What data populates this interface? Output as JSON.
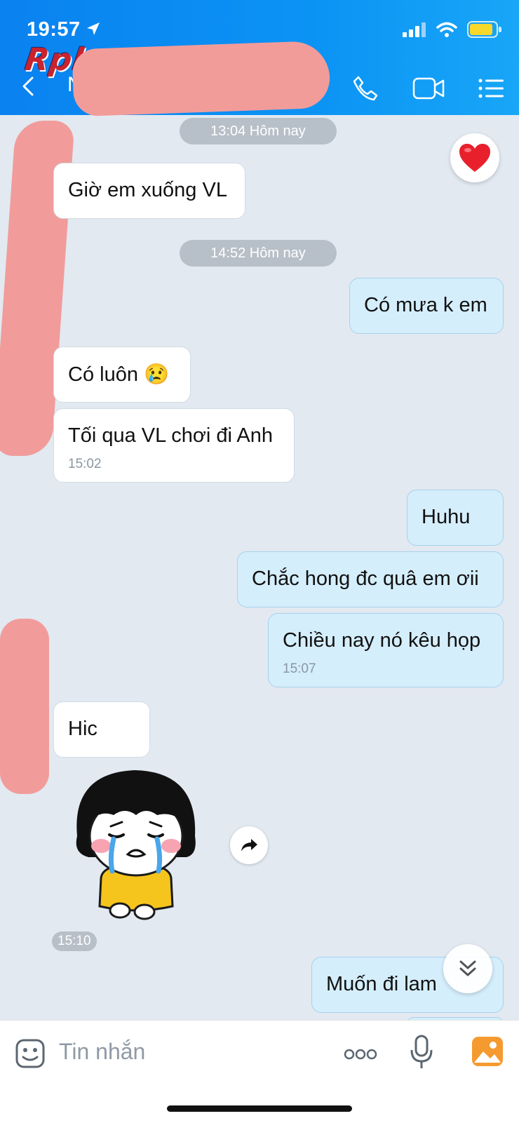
{
  "status_bar": {
    "time": "19:57"
  },
  "watermark": "Rphangx",
  "header": {
    "contact_name": "N"
  },
  "messages": {
    "sep1": "13:04 Hôm nay",
    "m1": "Giờ em xuống VL",
    "sep2": "14:52 Hôm nay",
    "m2": "Có mưa k em",
    "m3": "Có luôn 😢",
    "m4": "Tối qua VL chơi đi Anh",
    "m4_time": "15:02",
    "m5": "Huhu",
    "m6": "Chắc hong đc quâ em ơii",
    "m7": "Chiều nay nó kêu họp",
    "m7_time": "15:07",
    "m8": "Hic",
    "sticker_time": "15:10",
    "m9": "Muốn đi lam"
  },
  "input": {
    "placeholder": "Tin nhắn"
  },
  "colors": {
    "header": "#0a82f0",
    "incoming": "#ffffff",
    "outgoing": "#d5eefc",
    "background": "#e2e9f1"
  },
  "icons": [
    "location-arrow-icon",
    "signal-icon",
    "wifi-icon",
    "battery-icon",
    "back-icon",
    "phone-icon",
    "video-icon",
    "menu-icon",
    "heart-icon",
    "share-icon",
    "scroll-down-icon",
    "sticker-icon",
    "more-icon",
    "mic-icon",
    "image-icon"
  ]
}
